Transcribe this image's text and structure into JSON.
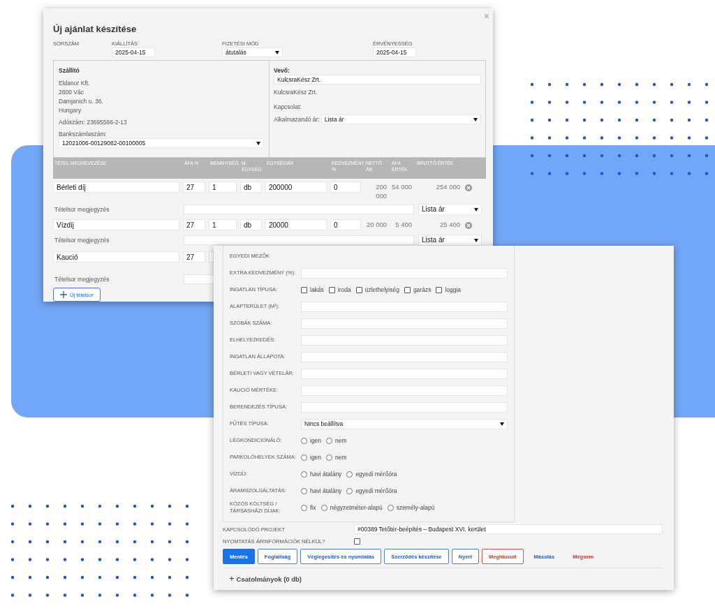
{
  "offer_window": {
    "title": "Új ajánlat készítése",
    "close": "×",
    "header": [
      {
        "label": "SORSZÁM",
        "kind": "empty"
      },
      {
        "label": "KIÁLLÍTÁS",
        "kind": "date",
        "value": "2025-04-15"
      },
      {
        "label": "FIZETÉSI MÓD",
        "kind": "select",
        "value": "átutalás"
      },
      {
        "label": "ÉRVÉNYESSÉG",
        "kind": "date",
        "value": "2025-04-15"
      }
    ],
    "supplier": {
      "heading": "Szállító",
      "address": [
        "Eldanor Kft.",
        "2600 Vác",
        "Damjanich u. 36.",
        "Hungary"
      ],
      "tax_number": "Adószám: 23695566-2-13",
      "bank_label": "Bankszámlaszám:",
      "bank_account": "12021006-00129082-00100005"
    },
    "buyer": {
      "heading": "Vevő:",
      "name_value": "KulcsraKész Zrt.",
      "name_text": "KulcsraKész Zrt.",
      "contact_label": "Kapcsolat:",
      "price_label": "Alkalmazandó ár:",
      "price_value": "Lista ár"
    },
    "table": {
      "columns": [
        "TÉTEL MEGNEVEZÉSE",
        "ÁFA %",
        "MENNYISÉG",
        "M. EGYSÉG",
        "EGYSÉGÁR",
        "KEDVEZMÉNY %",
        "NETTÓ ÁR",
        "ÁFA ÉRTÉK",
        "BRUTTÓ ÉRTÉK"
      ],
      "rows": [
        {
          "name": "Bérleti díj",
          "vat": "27",
          "quantity": "1",
          "unit": "db",
          "unit_price": "200000",
          "discount": "0",
          "net": "200 000",
          "vat_amount": "54 000",
          "gross": "254 000",
          "remove": true,
          "note_label": "Tételsor megjegyzés",
          "price_type": "Lista ár"
        },
        {
          "name": "Vízdíj",
          "vat": "27",
          "quantity": "1",
          "unit": "db",
          "unit_price": "20000",
          "discount": "0",
          "net": "20 000",
          "vat_amount": "5 400",
          "gross": "25 400",
          "remove": true,
          "note_label": "Tételsor megjegyzés",
          "price_type": "Lista ár"
        },
        {
          "name": "Kaució",
          "vat": "27",
          "note_label": "Tételsor megjegyzés"
        }
      ]
    },
    "add_row": "Új tételsor"
  },
  "details_window": {
    "custom_title": "EGYEDI MEZŐK",
    "custom_fields": [
      {
        "kind": "text",
        "label": "EXTRA KEDVEZMÉNY (%):"
      },
      {
        "kind": "checkboxes",
        "label": "INGATLAN TÍPUSA:",
        "options": [
          {
            "label": "lakás",
            "checked": false
          },
          {
            "label": "iroda",
            "checked": false
          },
          {
            "label": "üzlethelyiség",
            "checked": false
          },
          {
            "label": "garázs",
            "checked": false
          },
          {
            "label": "loggia",
            "checked": false
          }
        ]
      },
      {
        "kind": "text",
        "label": "ALAPTERÜLET (M²):"
      },
      {
        "kind": "text",
        "label": "SZOBÁK SZÁMA:"
      },
      {
        "kind": "text",
        "label": "ELHELYEZKEDÉS:"
      },
      {
        "kind": "text",
        "label": "INGATLAN ÁLLAPOTA:"
      },
      {
        "kind": "text",
        "label": "BÉRLETI VAGY VÉTELÁR:"
      },
      {
        "kind": "text",
        "label": "KAUCIÓ MÉRTÉKE:"
      },
      {
        "kind": "text",
        "label": "BERENDEZÉS TÍPUSA:"
      },
      {
        "kind": "select",
        "label": "FŰTÉS TÍPUSA:",
        "value": "Nincs beállítva"
      },
      {
        "kind": "radios",
        "label": "LÉGKONDICIONÁLÓ:",
        "options": [
          {
            "label": "igen",
            "selected": false
          },
          {
            "label": "nem",
            "selected": false
          }
        ]
      },
      {
        "kind": "radios",
        "label": "PARKOLÓHELYEK SZÁMA:",
        "options": [
          {
            "label": "igen",
            "selected": false
          },
          {
            "label": "nem",
            "selected": false
          }
        ]
      },
      {
        "kind": "radios",
        "label": "VÍZDÍJ:",
        "options": [
          {
            "label": "havi átalány",
            "selected": false
          },
          {
            "label": "egyedi mérőóra",
            "selected": false
          }
        ]
      },
      {
        "kind": "radios",
        "label": "ÁRAMSZOLGÁLTATÁS:",
        "options": [
          {
            "label": "havi átalány",
            "selected": false
          },
          {
            "label": "egyedi mérőóra",
            "selected": false
          }
        ]
      },
      {
        "kind": "radios",
        "label": "KÖZÖS KÖLTSÉG / TÁRSASHÁZI DÍJAK:",
        "options": [
          {
            "label": "fix",
            "selected": false
          },
          {
            "label": "négyzetméter-alapú",
            "selected": false
          },
          {
            "label": "személy-alapú",
            "selected": false
          }
        ]
      }
    ],
    "project_label": "KAPCSOLÓDÓ PROJEKT",
    "project_value": "#00389 Tetőtér-beépítés – Budapest XVI. kerület",
    "print_label": "NYOMTATÁS ÁRINFORMÁCIÓK NÉLKÜL?",
    "print_checked": false,
    "buttons": [
      {
        "label": "Mentés",
        "kind": "primary"
      },
      {
        "label": "Foglaltság",
        "kind": "outline"
      },
      {
        "label": "Véglegesítés és nyomtatás",
        "kind": "outline"
      },
      {
        "label": "Szerződés készítése",
        "kind": "outline"
      },
      {
        "label": "Nyert",
        "kind": "outline"
      },
      {
        "label": "Meghiúsult",
        "kind": "danger"
      },
      {
        "label": "Másolás",
        "kind": "link"
      },
      {
        "label": "Mégsem",
        "kind": "danger-link"
      }
    ],
    "attachments": {
      "icon": "+",
      "label": "Csatolmányok (0 db)"
    }
  }
}
